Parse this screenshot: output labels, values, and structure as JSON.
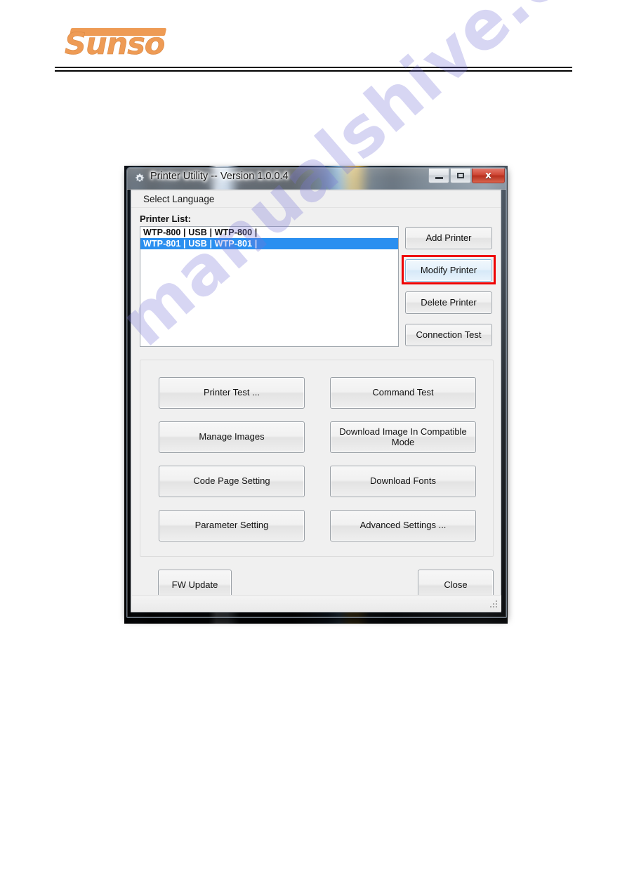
{
  "page": {
    "logo_text": "Sunso",
    "logo_color": "#ee9b55",
    "watermark": "manualshive.com"
  },
  "window": {
    "title": "Printer Utility -- Version 1.0.0.4",
    "icon": "gear-icon",
    "controls": {
      "minimize": "—",
      "maximize": "▭",
      "close": "x",
      "close_color": "#cf4634"
    }
  },
  "menubar": {
    "items": [
      {
        "label": "Select Language"
      }
    ]
  },
  "printer_section": {
    "label": "Printer List:",
    "items": [
      {
        "text": "WTP-800 | USB | WTP-800 |",
        "selected": false
      },
      {
        "text": "WTP-801 | USB | WTP-801 |",
        "selected": true
      }
    ],
    "selection_color": "#2a8ff0",
    "buttons": [
      {
        "label": "Add Printer"
      },
      {
        "label": "Modify Printer",
        "highlighted": true,
        "highlight_color": "#ee0000"
      },
      {
        "label": "Delete Printer"
      },
      {
        "label": "Connection Test"
      }
    ]
  },
  "actions": {
    "buttons": [
      {
        "label": "Printer Test ..."
      },
      {
        "label": "Command Test"
      },
      {
        "label": "Manage Images"
      },
      {
        "label": "Download Image In Compatible Mode"
      },
      {
        "label": "Code Page Setting"
      },
      {
        "label": "Download Fonts"
      },
      {
        "label": "Parameter Setting"
      },
      {
        "label": "Advanced Settings ..."
      }
    ]
  },
  "footer": {
    "fw_update": "FW Update",
    "close": "Close",
    "resize_grip": "resize-grip-icon"
  }
}
